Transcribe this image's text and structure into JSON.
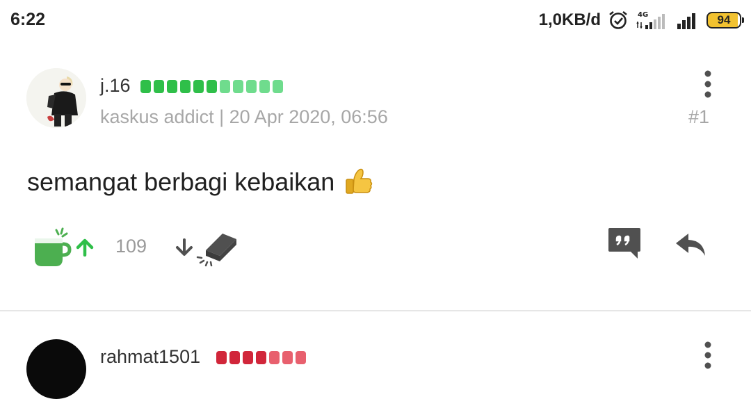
{
  "status_bar": {
    "time": "6:22",
    "net_speed": "1,0KB/d",
    "network_type": "4G",
    "battery_level": "94",
    "icons": [
      "alarm-icon",
      "signal-4g-icon",
      "signal-icon",
      "battery-icon"
    ]
  },
  "posts": [
    {
      "username": "j.16",
      "reputation": {
        "dark_dots": 6,
        "light_dots": 5,
        "dark_color": "#2fbf49",
        "light_color": "#6fdc8d"
      },
      "rank": "kaskus addict",
      "separator": "|",
      "timestamp": "20 Apr 2020, 06:56",
      "post_number": "#1",
      "body": "semangat berbagi kebaikan",
      "emoji_icon": "thumbs-up-icon",
      "vote_count": "109",
      "actions": [
        "cendol-icon",
        "upvote-icon",
        "downvote-icon",
        "bata-icon",
        "quote-icon",
        "reply-icon"
      ]
    },
    {
      "username": "rahmat1501",
      "reputation": {
        "dark_dots": 4,
        "light_dots": 3,
        "dark_color": "#d1263a",
        "light_color": "#e8606e"
      }
    }
  ],
  "colors": {
    "accent_green": "#2fbf49",
    "cendol_green": "#4caf50",
    "icon_gray": "#505050",
    "meta_gray": "#a7a7a7",
    "battery_yellow": "#f2c230"
  }
}
